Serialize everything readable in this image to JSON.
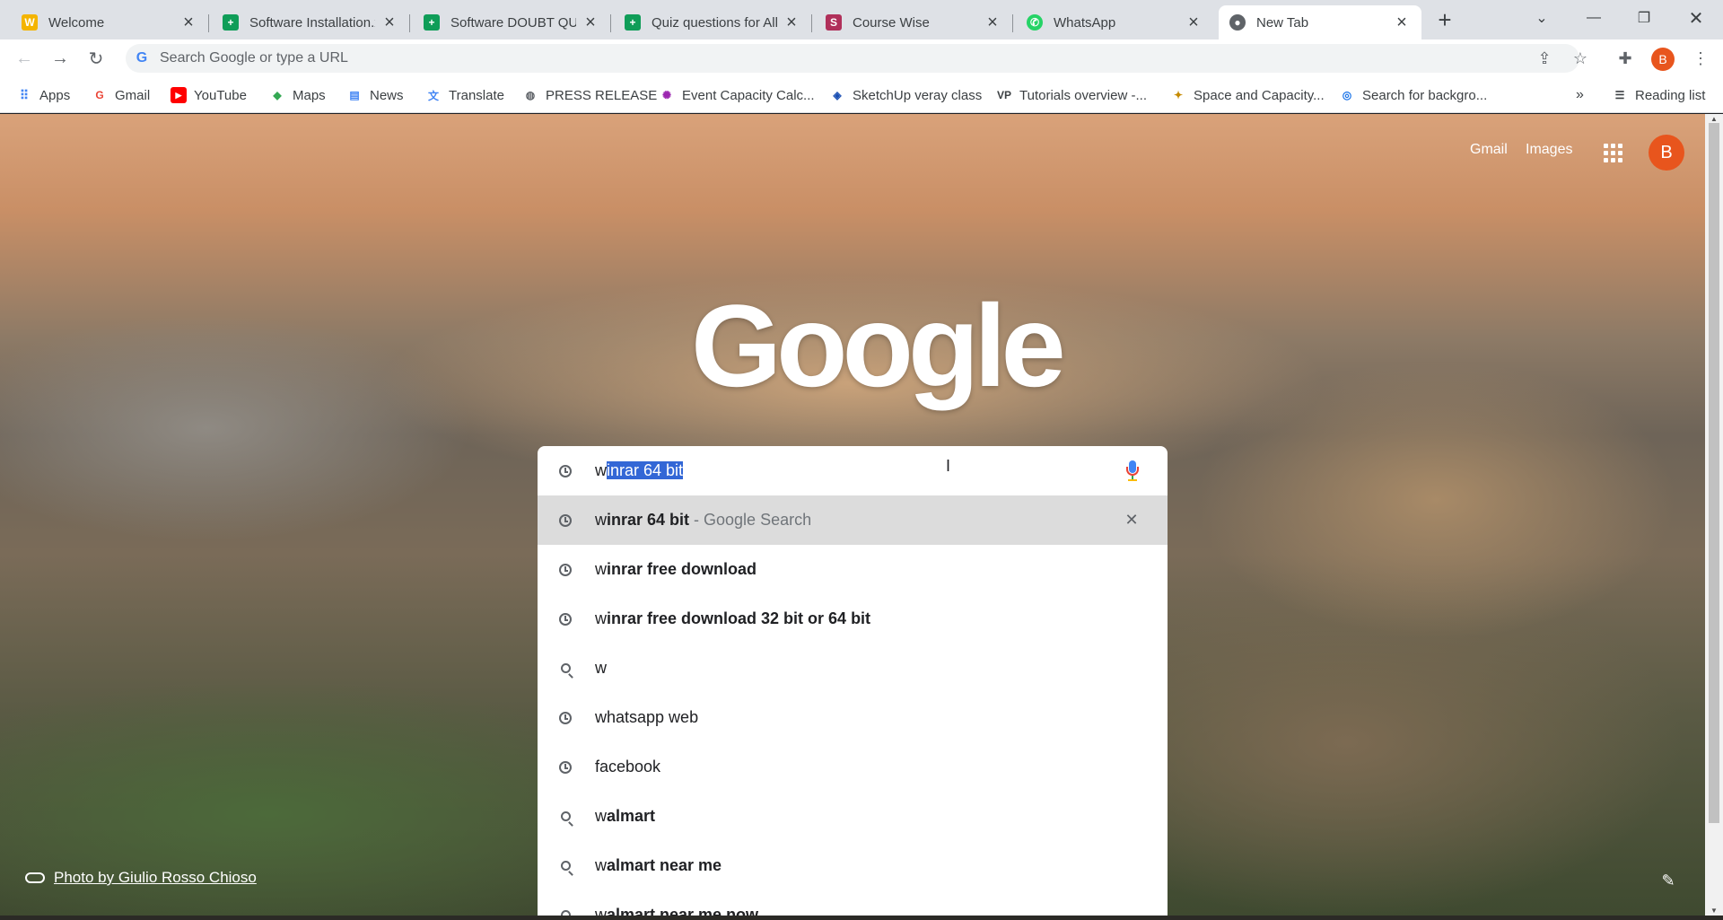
{
  "tabs": [
    {
      "title": "Welcome",
      "icon": "wb-icon",
      "color": "#f4b400"
    },
    {
      "title": "Software Installation.x",
      "icon": "sheets-icon",
      "color": "#0f9d58"
    },
    {
      "title": "Software DOUBT QUE",
      "icon": "sheets-icon",
      "color": "#0f9d58"
    },
    {
      "title": "Quiz questions for All",
      "icon": "sheets-icon",
      "color": "#0f9d58"
    },
    {
      "title": "Course Wise",
      "icon": "coursewise-icon",
      "color": "#b0305a"
    },
    {
      "title": "WhatsApp",
      "icon": "whatsapp-icon",
      "color": "#25d366"
    },
    {
      "title": "New Tab",
      "icon": "chrome-icon",
      "color": "#5f6368"
    }
  ],
  "omnibox": {
    "placeholder": "Search Google or type a URL"
  },
  "bookmarks": [
    {
      "label": "Apps"
    },
    {
      "label": "Gmail"
    },
    {
      "label": "YouTube"
    },
    {
      "label": "Maps"
    },
    {
      "label": "News"
    },
    {
      "label": "Translate"
    },
    {
      "label": "PRESS RELEASE"
    },
    {
      "label": "Event Capacity Calc..."
    },
    {
      "label": "SketchUp veray class"
    },
    {
      "label": "Tutorials overview -..."
    },
    {
      "label": "Space and Capacity..."
    },
    {
      "label": "Search for backgro..."
    }
  ],
  "reading_list": "Reading list",
  "more_bookmarks": "»",
  "header": {
    "gmail": "Gmail",
    "images": "Images",
    "avatar": "B"
  },
  "logo": "Google",
  "search": {
    "typed": "w",
    "selected": "inrar 64 bit"
  },
  "suggestions": [
    {
      "prefix": "w",
      "rest": "inrar 64 bit",
      "suffix": " - Google Search",
      "icon": "clock-icon",
      "highlighted": true
    },
    {
      "prefix": "w",
      "rest": "inrar free download",
      "suffix": "",
      "icon": "clock-icon"
    },
    {
      "prefix": "w",
      "rest": "inrar free download 32 bit or 64 bit",
      "suffix": "",
      "icon": "clock-icon"
    },
    {
      "prefix": "w",
      "rest": "",
      "suffix": "",
      "icon": "search-icon"
    },
    {
      "prefix": "",
      "rest": "whatsapp web",
      "suffix": "",
      "icon": "clock-icon",
      "plain": true
    },
    {
      "prefix": "",
      "rest": "facebook",
      "suffix": "",
      "icon": "clock-icon",
      "plain": true
    },
    {
      "prefix": "w",
      "rest": "almart",
      "suffix": "",
      "icon": "search-icon"
    },
    {
      "prefix": "w",
      "rest": "almart near me",
      "suffix": "",
      "icon": "search-icon"
    },
    {
      "prefix": "w",
      "rest": "almart near me now",
      "suffix": "",
      "icon": "search-icon"
    }
  ],
  "photo_credit": "Photo by Giulio Rosso Chioso",
  "colors": {
    "accent": "#1a73e8",
    "avatar": "#e8551d",
    "selection": "#3367d6"
  }
}
